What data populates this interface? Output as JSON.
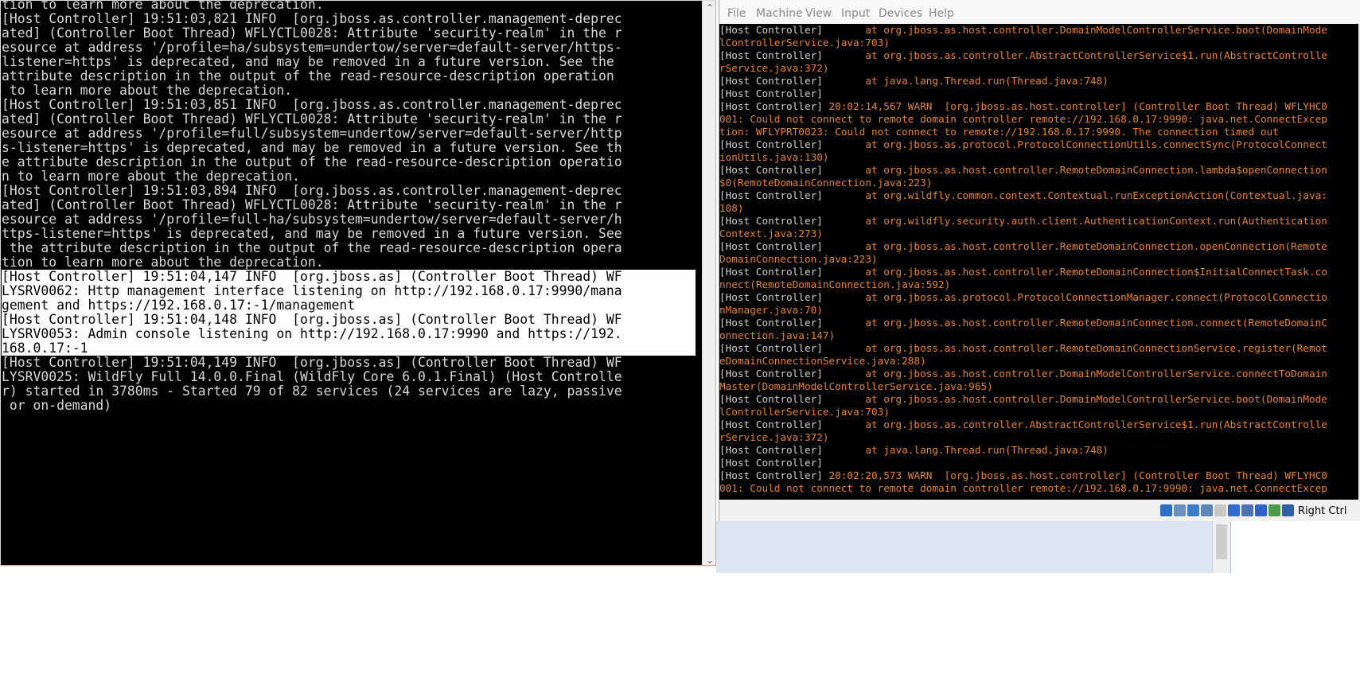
{
  "cmd": {
    "lines": [
      {
        "t": "tion to learn more about the deprecation.",
        "sel": false
      },
      {
        "t": "[Host Controller] 19:51:03,821 INFO  [org.jboss.as.controller.management-deprec",
        "sel": false
      },
      {
        "t": "ated] (Controller Boot Thread) WFLYCTL0028: Attribute 'security-realm' in the r",
        "sel": false
      },
      {
        "t": "esource at address '/profile=ha/subsystem=undertow/server=default-server/https-",
        "sel": false
      },
      {
        "t": "listener=https' is deprecated, and may be removed in a future version. See the",
        "sel": false
      },
      {
        "t": "attribute description in the output of the read-resource-description operation",
        "sel": false
      },
      {
        "t": " to learn more about the deprecation.",
        "sel": false
      },
      {
        "t": "[Host Controller] 19:51:03,851 INFO  [org.jboss.as.controller.management-deprec",
        "sel": false
      },
      {
        "t": "ated] (Controller Boot Thread) WFLYCTL0028: Attribute 'security-realm' in the r",
        "sel": false
      },
      {
        "t": "esource at address '/profile=full/subsystem=undertow/server=default-server/http",
        "sel": false
      },
      {
        "t": "s-listener=https' is deprecated, and may be removed in a future version. See th",
        "sel": false
      },
      {
        "t": "e attribute description in the output of the read-resource-description operatio",
        "sel": false
      },
      {
        "t": "n to learn more about the deprecation.",
        "sel": false
      },
      {
        "t": "[Host Controller] 19:51:03,894 INFO  [org.jboss.as.controller.management-deprec",
        "sel": false
      },
      {
        "t": "ated] (Controller Boot Thread) WFLYCTL0028: Attribute 'security-realm' in the r",
        "sel": false
      },
      {
        "t": "esource at address '/profile=full-ha/subsystem=undertow/server=default-server/h",
        "sel": false
      },
      {
        "t": "ttps-listener=https' is deprecated, and may be removed in a future version. See",
        "sel": false
      },
      {
        "t": " the attribute description in the output of the read-resource-description opera",
        "sel": false
      },
      {
        "t": "tion to learn more about the deprecation.",
        "sel": false
      },
      {
        "t": "[Host Controller] 19:51:04,147 INFO  [org.jboss.as] (Controller Boot Thread) WF",
        "sel": true
      },
      {
        "t": "LYSRV0062: Http management interface listening on http://192.168.0.17:9990/mana",
        "sel": true
      },
      {
        "t": "gement and https://192.168.0.17:-1/management",
        "sel": true
      },
      {
        "t": "[Host Controller] 19:51:04,148 INFO  [org.jboss.as] (Controller Boot Thread) WF",
        "sel": true
      },
      {
        "t": "LYSRV0053: Admin console listening on http://192.168.0.17:9990 and https://192.",
        "sel": true
      },
      {
        "t": "168.0.17:-1",
        "sel": true
      },
      {
        "t": "[Host Controller] 19:51:04,149 INFO  [org.jboss.as] (Controller Boot Thread) WF",
        "sel": false
      },
      {
        "t": "LYSRV0025: WildFly Full 14.0.0.Final (WildFly Core 6.0.1.Final) (Host Controlle",
        "sel": false
      },
      {
        "t": "r) started in 3780ms - Started 79 of 82 services (24 services are lazy, passive",
        "sel": false
      },
      {
        "t": " or on-demand)",
        "sel": false
      }
    ]
  },
  "vm": {
    "menu": [
      "File",
      "Machine",
      "View",
      "Input",
      "Devices",
      "Help"
    ],
    "status_label": "Right Ctrl",
    "lines": [
      {
        "p": "[Host Controller]       ",
        "o": "at org.jboss.as.host.controller.DomainModelControllerService.boot(DomainMode"
      },
      {
        "p": "",
        "o": "lControllerService.java:703)"
      },
      {
        "p": "[Host Controller]       ",
        "o": "at org.jboss.as.controller.AbstractControllerService$1.run(AbstractControlle"
      },
      {
        "p": "",
        "o": "rService.java:372)"
      },
      {
        "p": "[Host Controller]       ",
        "o": "at java.lang.Thread.run(Thread.java:748)"
      },
      {
        "p": "[Host Controller]",
        "o": ""
      },
      {
        "p": "[Host Controller] ",
        "o": "20:02:14,567 WARN  [org.jboss.as.host.controller] (Controller Boot Thread) WFLYHC0"
      },
      {
        "p": "",
        "o": "001: Could not connect to remote domain controller remote://192.168.0.17:9990: java.net.ConnectExcep"
      },
      {
        "p": "",
        "o": "tion: WFLYPRT0023: Could not connect to remote://192.168.0.17:9990. The connection timed out"
      },
      {
        "p": "[Host Controller]       ",
        "o": "at org.jboss.as.protocol.ProtocolConnectionUtils.connectSync(ProtocolConnect"
      },
      {
        "p": "",
        "o": "ionUtils.java:130)"
      },
      {
        "p": "[Host Controller]       ",
        "o": "at org.jboss.as.host.controller.RemoteDomainConnection.lambda$openConnection"
      },
      {
        "p": "",
        "o": "$0(RemoteDomainConnection.java:223)"
      },
      {
        "p": "[Host Controller]       ",
        "o": "at org.wildfly.common.context.Contextual.runExceptionAction(Contextual.java:"
      },
      {
        "p": "",
        "o": "108)"
      },
      {
        "p": "[Host Controller]       ",
        "o": "at org.wildfly.security.auth.client.AuthenticationContext.run(Authentication"
      },
      {
        "p": "",
        "o": "Context.java:273)"
      },
      {
        "p": "[Host Controller]       ",
        "o": "at org.jboss.as.host.controller.RemoteDomainConnection.openConnection(Remote"
      },
      {
        "p": "",
        "o": "DomainConnection.java:223)"
      },
      {
        "p": "[Host Controller]       ",
        "o": "at org.jboss.as.host.controller.RemoteDomainConnection$InitialConnectTask.co"
      },
      {
        "p": "",
        "o": "nnect(RemoteDomainConnection.java:592)"
      },
      {
        "p": "[Host Controller]       ",
        "o": "at org.jboss.as.protocol.ProtocolConnectionManager.connect(ProtocolConnectio"
      },
      {
        "p": "",
        "o": "nManager.java:70)"
      },
      {
        "p": "[Host Controller]       ",
        "o": "at org.jboss.as.host.controller.RemoteDomainConnection.connect(RemoteDomainC"
      },
      {
        "p": "",
        "o": "onnection.java:147)"
      },
      {
        "p": "[Host Controller]       ",
        "o": "at org.jboss.as.host.controller.RemoteDomainConnectionService.register(Remot"
      },
      {
        "p": "",
        "o": "eDomainConnectionService.java:288)"
      },
      {
        "p": "[Host Controller]       ",
        "o": "at org.jboss.as.host.controller.DomainModelControllerService.connectToDomain"
      },
      {
        "p": "",
        "o": "Master(DomainModelControllerService.java:965)"
      },
      {
        "p": "[Host Controller]       ",
        "o": "at org.jboss.as.host.controller.DomainModelControllerService.boot(DomainMode"
      },
      {
        "p": "",
        "o": "lControllerService.java:703)"
      },
      {
        "p": "[Host Controller]       ",
        "o": "at org.jboss.as.controller.AbstractControllerService$1.run(AbstractControlle"
      },
      {
        "p": "",
        "o": "rService.java:372)"
      },
      {
        "p": "[Host Controller]       ",
        "o": "at java.lang.Thread.run(Thread.java:748)"
      },
      {
        "p": "[Host Controller]",
        "o": ""
      },
      {
        "p": "[Host Controller] ",
        "o": "20:02:20,573 WARN  [org.jboss.as.host.controller] (Controller Boot Thread) WFLYHC0"
      },
      {
        "p": "",
        "o": "001: Could not connect to remote domain controller remote://192.168.0.17:9990: java.net.ConnectExcep"
      }
    ]
  },
  "colors": {
    "orange": "#e8842c",
    "console_bg": "#000000",
    "console_fg": "#d8d8d8"
  }
}
